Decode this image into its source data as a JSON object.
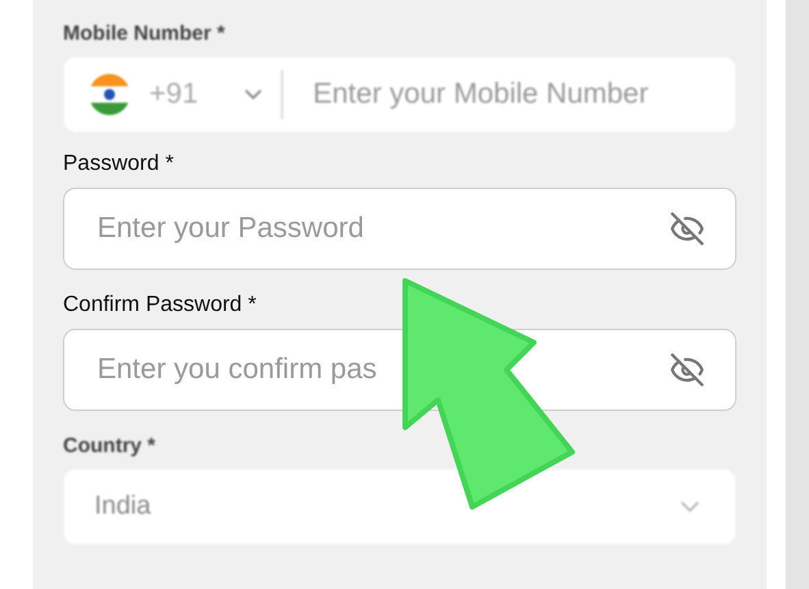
{
  "fields": [
    {
      "kind": "phone",
      "label": "Mobile Number *",
      "code": "+91",
      "placeholder": "Enter your Mobile Number",
      "blurred": true
    },
    {
      "kind": "password",
      "label": "Password *",
      "placeholder": "Enter your Password",
      "blurred": false
    },
    {
      "kind": "password",
      "label": "Confirm Password *",
      "placeholder": "Enter you confirm pas",
      "blurred": false
    },
    {
      "kind": "select",
      "label": "Country *",
      "value": "India",
      "blurred": true
    }
  ]
}
